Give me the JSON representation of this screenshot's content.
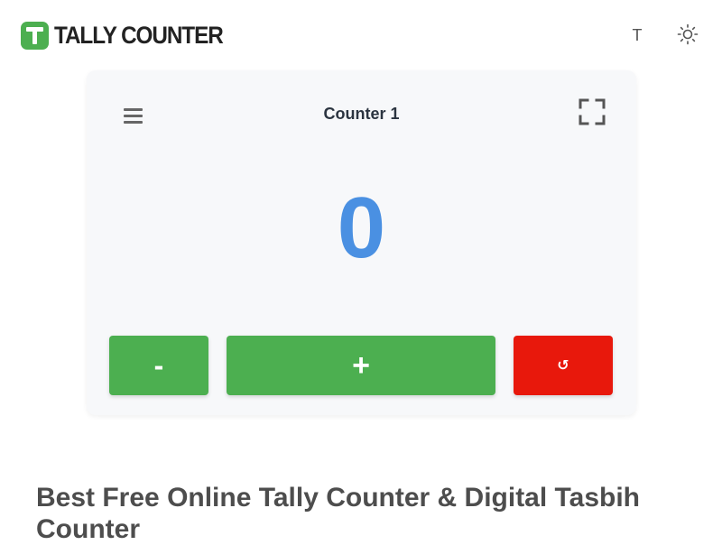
{
  "header": {
    "logo_letter": "T",
    "logo_text": "TALLY COUNTER",
    "font_toggle_label": "T",
    "theme_icon": "sun-icon",
    "brand_color": "#4caf50"
  },
  "counter": {
    "title": "Counter 1",
    "value": "0",
    "menu_icon": "hamburger-menu-icon",
    "fullscreen_icon": "fullscreen-icon",
    "value_color": "#4a90e2"
  },
  "buttons": {
    "decrement_label": "-",
    "increment_label": "+",
    "reset_label": "↺",
    "green": "#4caf50",
    "red": "#e8180c"
  },
  "content": {
    "headline": "Best Free Online Tally Counter & Digital Tasbih Counter"
  }
}
